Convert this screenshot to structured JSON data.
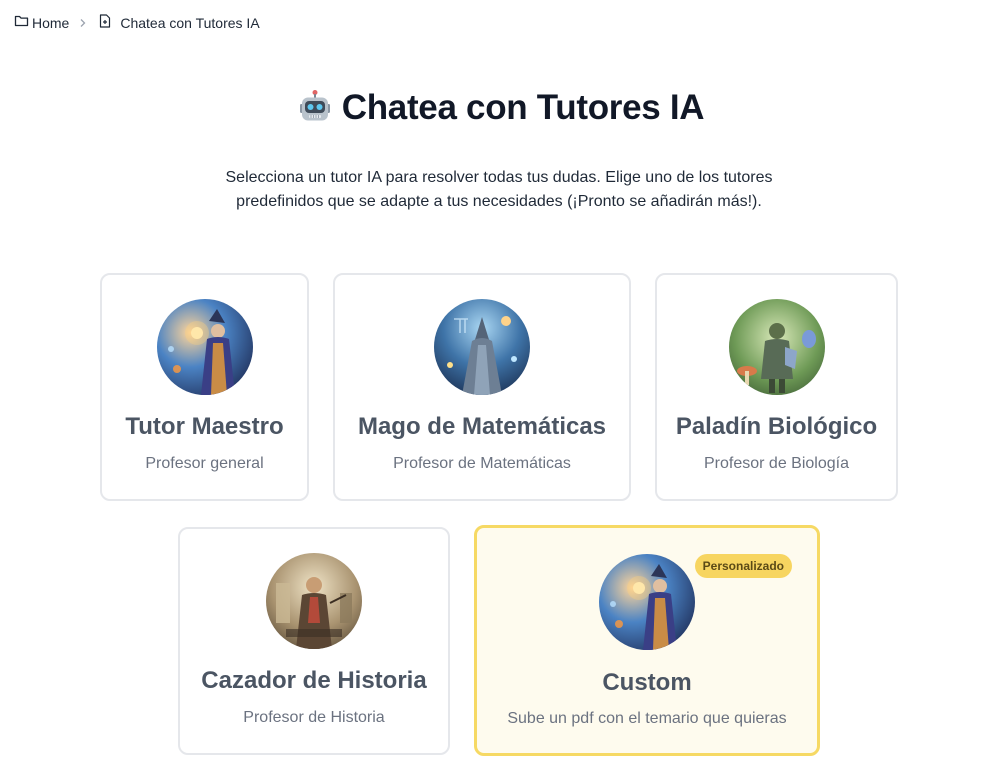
{
  "breadcrumb": {
    "home_label": "Home",
    "current_label": "Chatea con Tutores IA"
  },
  "header": {
    "emoji": "🤖",
    "title": "Chatea con Tutores IA",
    "intro": "Selecciona un tutor IA para resolver todas tus dudas. Elige uno de los tutores predefinidos que se adapte a tus necesidades (¡Pronto se añadirán más!)."
  },
  "tutors": [
    {
      "name": "Tutor Maestro",
      "description": "Profesor general",
      "avatar": "wizard-portrait"
    },
    {
      "name": "Mago de Matemáticas",
      "description": "Profesor de Matemáticas",
      "avatar": "math-wizard-portrait"
    },
    {
      "name": "Paladín Biológico",
      "description": "Profesor de Biología",
      "avatar": "biology-paladin-portrait"
    },
    {
      "name": "Cazador de Historia",
      "description": "Profesor de Historia",
      "avatar": "history-hunter-portrait"
    },
    {
      "name": "Custom",
      "description": "Sube un pdf con el temario que quieras",
      "avatar": "wizard-portrait",
      "badge": "Personalizado"
    }
  ],
  "colors": {
    "custom_card_bg": "#fefbee",
    "custom_card_border": "#f6d964",
    "badge_bg": "#f7d560"
  }
}
